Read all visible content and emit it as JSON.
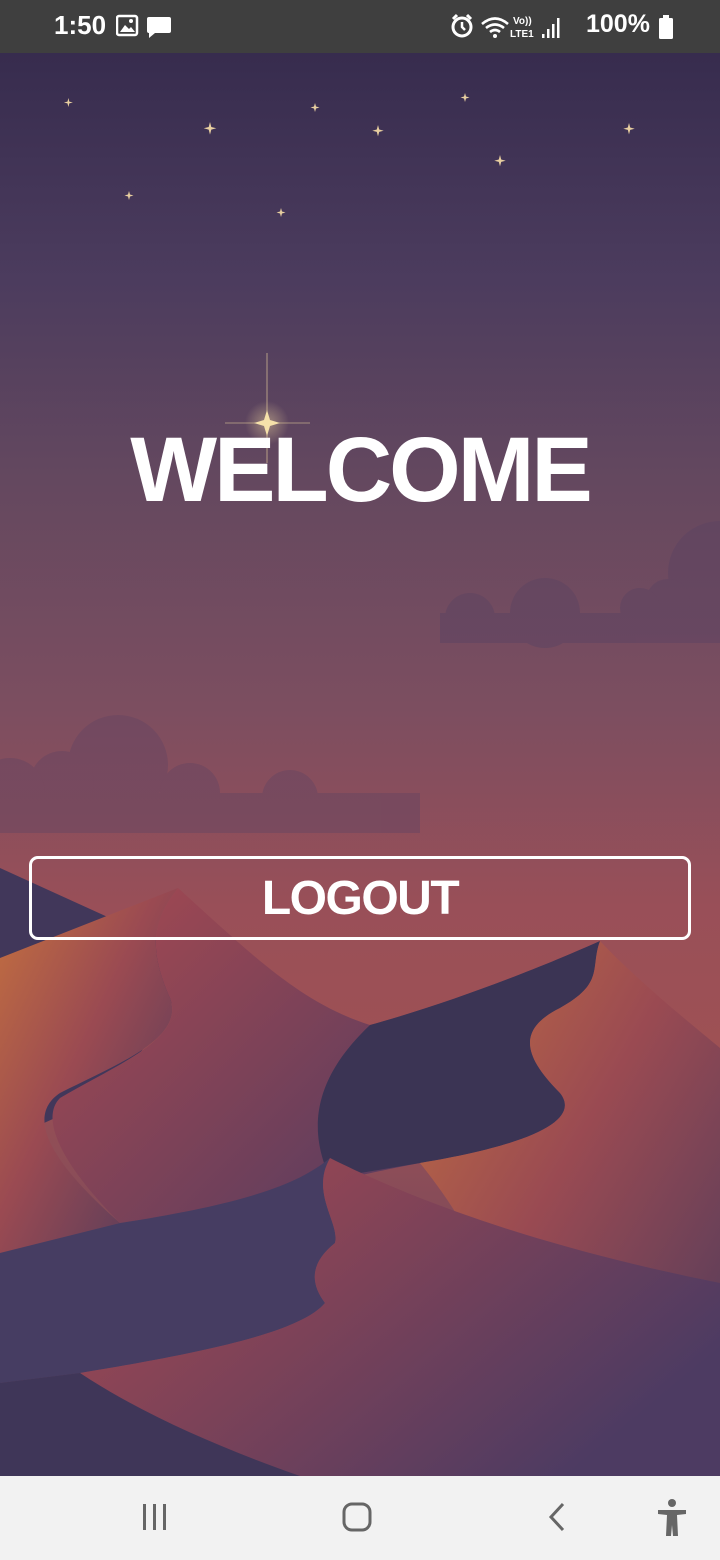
{
  "status_bar": {
    "time": "1:50",
    "battery": "100%",
    "network_label": "Vo)) LTE1",
    "icons": [
      "image-icon",
      "message-icon",
      "alarm-icon",
      "wifi-icon",
      "volte-icon",
      "signal-icon",
      "battery-icon"
    ]
  },
  "main": {
    "title": "WELCOME",
    "logout_label": "LOGOUT"
  },
  "nav_bar": {
    "icons": [
      "recent-apps-icon",
      "home-icon",
      "back-icon",
      "accessibility-icon"
    ]
  },
  "colors": {
    "status_bar_bg": "#3f3f3f",
    "nav_bar_bg": "#f2f2f2",
    "text": "#ffffff",
    "sky_top": "#372c4e",
    "sky_bottom": "#9e5154",
    "dune_dark": "#3b3555",
    "dune_light": "#c26a45"
  }
}
